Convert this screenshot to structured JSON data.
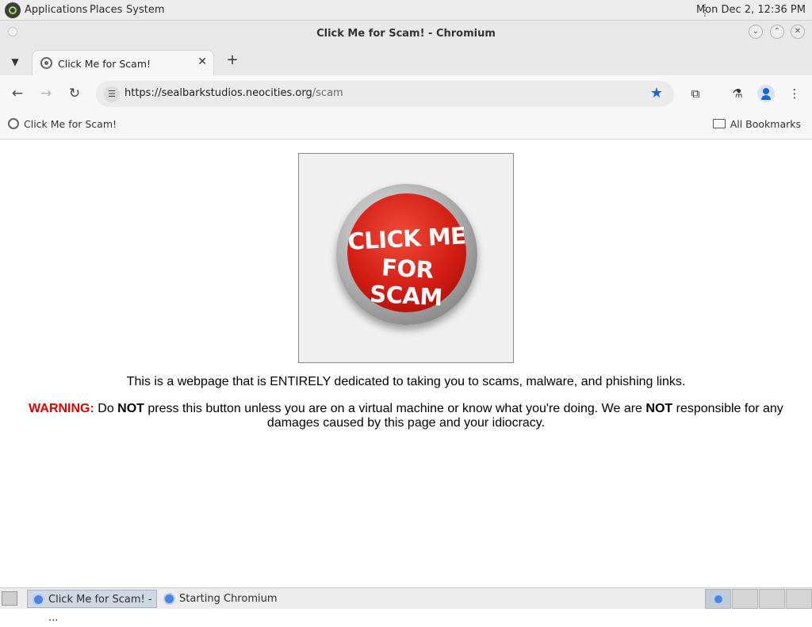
{
  "desktop": {
    "menus": [
      "Applications",
      "Places",
      "System"
    ],
    "clock": "Mon Dec  2, 12:36 PM"
  },
  "window": {
    "title": "Click Me for Scam! - Chromium"
  },
  "tab": {
    "title": "Click Me for Scam!"
  },
  "toolbar": {
    "url_host": "https://sealbarkstudios.neocities.org",
    "url_path": "/scam"
  },
  "bookmarks": {
    "item": "Click Me for Scam!",
    "all": "All Bookmarks"
  },
  "page": {
    "button_line1": "CLICK ME",
    "button_line2": "FOR SCAM",
    "description": "This is a webpage that is ENTIRELY dedicated to taking you to scams, malware, and phishing links.",
    "warning_label": "WARNING:",
    "warning_do": " Do ",
    "warning_not1": "NOT",
    "warning_mid": " press this button unless you are on a virtual machine or know what you're doing. We are ",
    "warning_not2": "NOT",
    "warning_end": " responsible for any damages caused by this page and your idiocracy."
  },
  "taskbar": {
    "task1": "Click Me for Scam! - ...",
    "task2": "Starting Chromium"
  },
  "colors": {
    "accent": "#1a63d8",
    "warning": "#e00000",
    "button_red": "#d21d14"
  }
}
